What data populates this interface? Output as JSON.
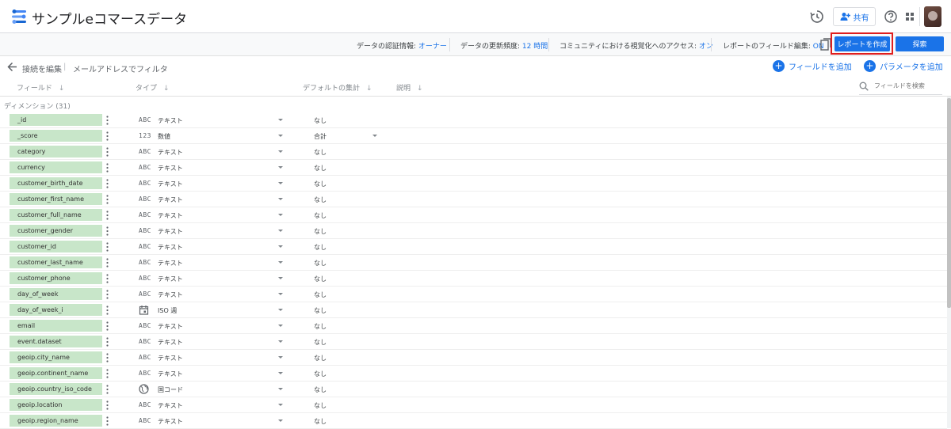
{
  "header": {
    "title": "サンプルeコマースデータ",
    "share_label": "共有"
  },
  "infobar": {
    "credentials_label": "データの認証情報:",
    "credentials_value": "オーナー",
    "freshness_label": "データの更新頻度:",
    "freshness_value": "12 時間",
    "community_label": "コミュニティにおける視覚化へのアクセス:",
    "community_value": "オン",
    "field_edit_label": "レポートのフィールド編集:",
    "field_edit_value": "ON",
    "create_report_label": "レポートを作成",
    "explore_label": "探索"
  },
  "actionbar": {
    "edit_connection": "接続を編集",
    "separator": "|",
    "filter_by_email": "メールアドレスでフィルタ",
    "add_field": "フィールドを追加",
    "add_parameter": "パラメータを追加"
  },
  "columns": {
    "field": "フィールド",
    "type": "タイプ",
    "default_agg": "デフォルトの集計",
    "description": "説明",
    "search_placeholder": "フィールドを検索"
  },
  "section_label": "ディメンション (31)",
  "rows": [
    {
      "name": "_id",
      "type_icon": "ABC",
      "type": "テキスト",
      "agg": "なし"
    },
    {
      "name": "_score",
      "type_icon": "123",
      "type": "数値",
      "agg": "合計"
    },
    {
      "name": "category",
      "type_icon": "ABC",
      "type": "テキスト",
      "agg": "なし"
    },
    {
      "name": "currency",
      "type_icon": "ABC",
      "type": "テキスト",
      "agg": "なし"
    },
    {
      "name": "customer_birth_date",
      "type_icon": "ABC",
      "type": "テキスト",
      "agg": "なし"
    },
    {
      "name": "customer_first_name",
      "type_icon": "ABC",
      "type": "テキスト",
      "agg": "なし"
    },
    {
      "name": "customer_full_name",
      "type_icon": "ABC",
      "type": "テキスト",
      "agg": "なし"
    },
    {
      "name": "customer_gender",
      "type_icon": "ABC",
      "type": "テキスト",
      "agg": "なし"
    },
    {
      "name": "customer_id",
      "type_icon": "ABC",
      "type": "テキスト",
      "agg": "なし"
    },
    {
      "name": "customer_last_name",
      "type_icon": "ABC",
      "type": "テキスト",
      "agg": "なし"
    },
    {
      "name": "customer_phone",
      "type_icon": "ABC",
      "type": "テキスト",
      "agg": "なし"
    },
    {
      "name": "day_of_week",
      "type_icon": "ABC",
      "type": "テキスト",
      "agg": "なし"
    },
    {
      "name": "day_of_week_i",
      "type_icon": "calendar-icon",
      "type": "ISO 週",
      "agg": "なし"
    },
    {
      "name": "email",
      "type_icon": "ABC",
      "type": "テキスト",
      "agg": "なし"
    },
    {
      "name": "event.dataset",
      "type_icon": "ABC",
      "type": "テキスト",
      "agg": "なし"
    },
    {
      "name": "geoip.city_name",
      "type_icon": "ABC",
      "type": "テキスト",
      "agg": "なし"
    },
    {
      "name": "geoip.continent_name",
      "type_icon": "ABC",
      "type": "テキスト",
      "agg": "なし"
    },
    {
      "name": "geoip.country_iso_code",
      "type_icon": "globe-icon",
      "type": "国コード",
      "agg": "なし"
    },
    {
      "name": "geoip.location",
      "type_icon": "ABC",
      "type": "テキスト",
      "agg": "なし"
    },
    {
      "name": "geoip.region_name",
      "type_icon": "ABC",
      "type": "テキスト",
      "agg": "なし"
    }
  ],
  "colors": {
    "accent": "#1a73e8",
    "field_chip": "#c8e6c9",
    "highlight_border": "#e01e1e"
  }
}
